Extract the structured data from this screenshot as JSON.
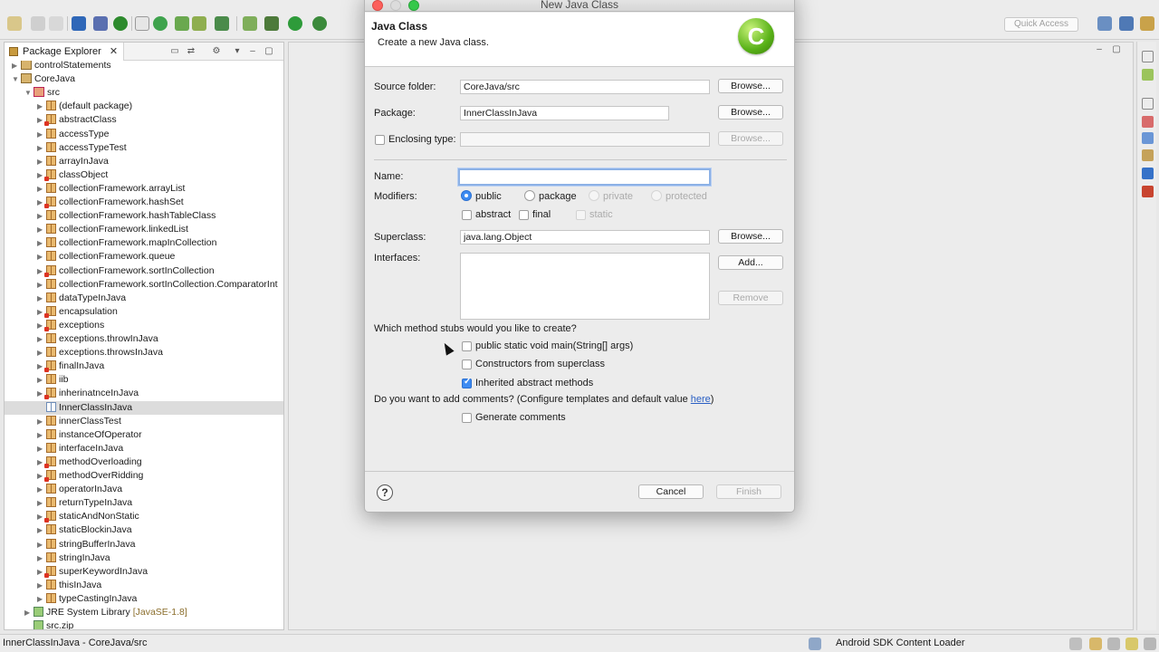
{
  "toolbar": {
    "quick_access_placeholder": "Quick Access"
  },
  "explorer": {
    "tab_label": "Package Explorer",
    "rows": [
      {
        "label": "controlStatements",
        "kind": "project"
      },
      {
        "label": "CoreJava",
        "kind": "project"
      },
      {
        "label": "src",
        "kind": "src"
      },
      {
        "label": "(default package)",
        "kind": "pkg"
      },
      {
        "label": "abstractClass",
        "kind": "pkg"
      },
      {
        "label": "accessType",
        "kind": "pkg"
      },
      {
        "label": "accessTypeTest",
        "kind": "pkg"
      },
      {
        "label": "arrayInJava",
        "kind": "pkg"
      },
      {
        "label": "classObject",
        "kind": "pkg"
      },
      {
        "label": "collectionFramework.arrayList",
        "kind": "pkg"
      },
      {
        "label": "collectionFramework.hashSet",
        "kind": "pkg"
      },
      {
        "label": "collectionFramework.hashTableClass",
        "kind": "pkg"
      },
      {
        "label": "collectionFramework.linkedList",
        "kind": "pkg"
      },
      {
        "label": "collectionFramework.mapInCollection",
        "kind": "pkg"
      },
      {
        "label": "collectionFramework.queue",
        "kind": "pkg"
      },
      {
        "label": "collectionFramework.sortInCollection",
        "kind": "pkg"
      },
      {
        "label": "collectionFramework.sortInCollection.ComparatorInt",
        "kind": "pkg"
      },
      {
        "label": "dataTypeInJava",
        "kind": "pkg"
      },
      {
        "label": "encapsulation",
        "kind": "pkg"
      },
      {
        "label": "exceptions",
        "kind": "pkg"
      },
      {
        "label": "exceptions.throwInJava",
        "kind": "pkg"
      },
      {
        "label": "exceptions.throwsInJava",
        "kind": "pkg"
      },
      {
        "label": "finalInJava",
        "kind": "pkg"
      },
      {
        "label": "iib",
        "kind": "pkg"
      },
      {
        "label": "inherinatnceInJava",
        "kind": "pkg"
      },
      {
        "label": "InnerClassInJava",
        "kind": "pkg"
      },
      {
        "label": "innerClassTest",
        "kind": "pkg"
      },
      {
        "label": "instanceOfOperator",
        "kind": "pkg"
      },
      {
        "label": "interfaceInJava",
        "kind": "pkg"
      },
      {
        "label": "methodOverloading",
        "kind": "pkg"
      },
      {
        "label": "methodOverRidding",
        "kind": "pkg"
      },
      {
        "label": "operatorInJava",
        "kind": "pkg"
      },
      {
        "label": "returnTypeInJava",
        "kind": "pkg"
      },
      {
        "label": "staticAndNonStatic",
        "kind": "pkg"
      },
      {
        "label": "staticBlockinJava",
        "kind": "pkg"
      },
      {
        "label": "stringBufferInJava",
        "kind": "pkg"
      },
      {
        "label": "stringInJava",
        "kind": "pkg"
      },
      {
        "label": "superKeywordInJava",
        "kind": "pkg"
      },
      {
        "label": "thisInJava",
        "kind": "pkg"
      },
      {
        "label": "typeCastingInJava",
        "kind": "pkg"
      },
      {
        "label": "JRE System Library",
        "kind": "lib",
        "suffix": "[JavaSE-1.8]"
      },
      {
        "label": "src.zip",
        "kind": "jar"
      }
    ]
  },
  "dialog": {
    "window_title": "New Java Class",
    "header_title": "Java Class",
    "header_desc": "Create a new Java class.",
    "source_folder_label": "Source folder:",
    "source_folder_value": "CoreJava/src",
    "package_label": "Package:",
    "package_value": "InnerClassInJava",
    "enclosing_label": "Enclosing type:",
    "enclosing_value": "",
    "name_label": "Name:",
    "name_value": "",
    "modifiers_label": "Modifiers:",
    "mod_public": "public",
    "mod_package": "package",
    "mod_private": "private",
    "mod_protected": "protected",
    "mod_abstract": "abstract",
    "mod_final": "final",
    "mod_static": "static",
    "superclass_label": "Superclass:",
    "superclass_value": "java.lang.Object",
    "interfaces_label": "Interfaces:",
    "browse": "Browse...",
    "add": "Add...",
    "remove": "Remove",
    "stubs_question": "Which method stubs would you like to create?",
    "stub_main": "public static void main(String[] args)",
    "stub_constructors": "Constructors from superclass",
    "stub_inherited": "Inherited abstract methods",
    "comments_question_pre": "Do you want to add comments? (Configure templates and default value ",
    "comments_link": "here",
    "comments_question_post": ")",
    "generate_comments": "Generate comments",
    "help": "?",
    "cancel": "Cancel",
    "finish": "Finish"
  },
  "status": {
    "left_text": "InnerClassInJava - CoreJava/src",
    "loader_text": "Android SDK Content Loader"
  }
}
